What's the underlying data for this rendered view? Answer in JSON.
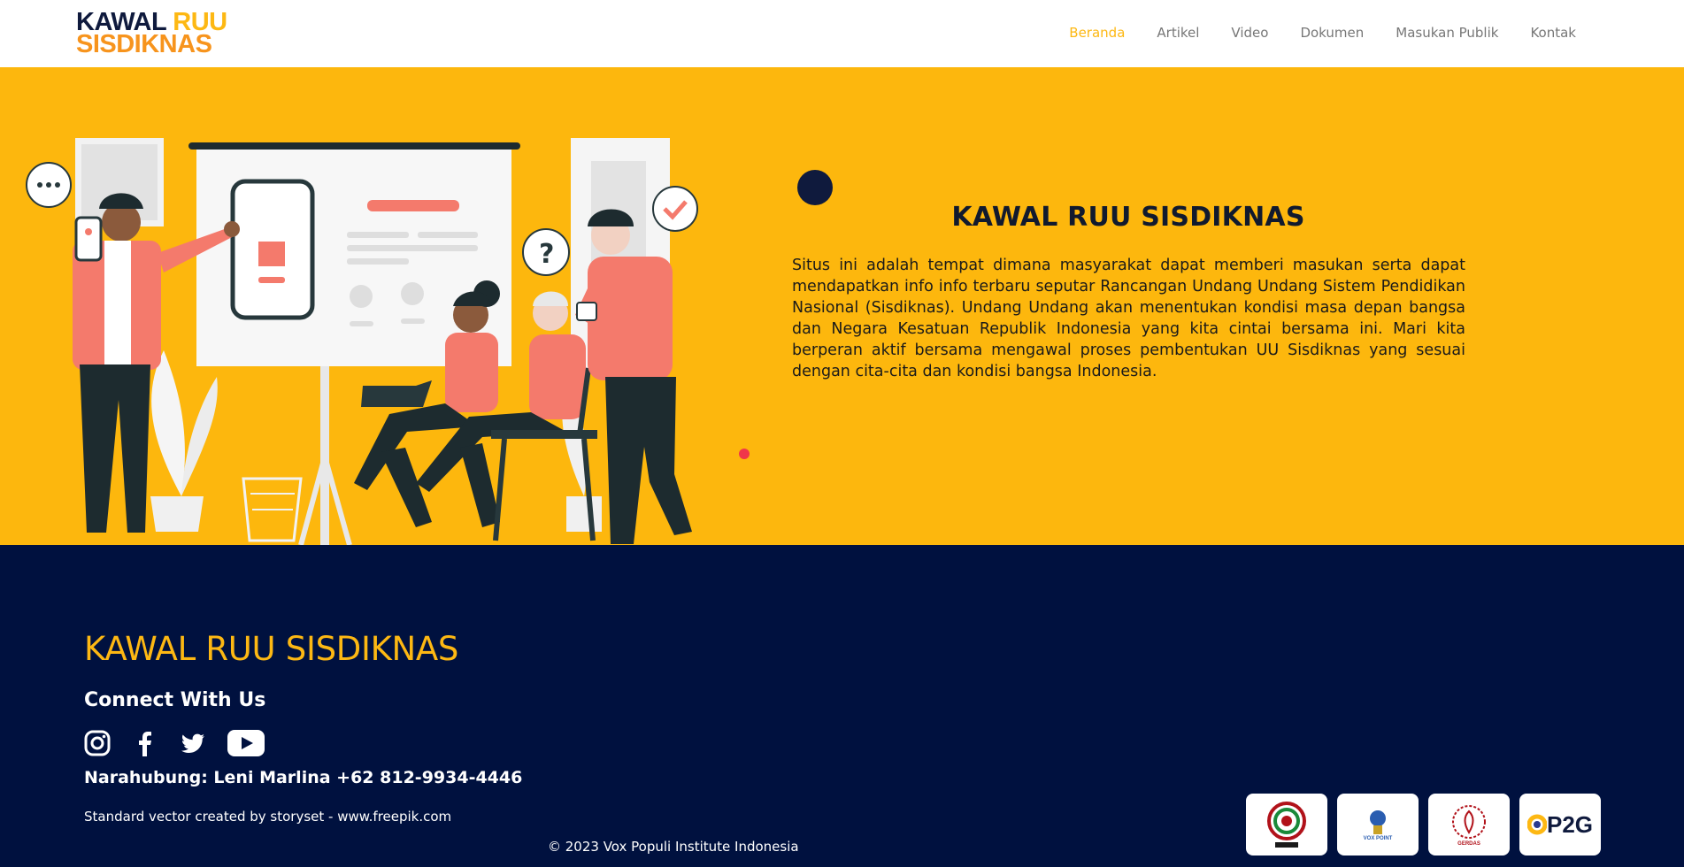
{
  "brand": {
    "line1_a": "KAWAL ",
    "line1_b": "RUU",
    "line2": "SISDIKNAS"
  },
  "nav": {
    "items": [
      {
        "label": "Beranda",
        "active": true
      },
      {
        "label": "Artikel",
        "active": false
      },
      {
        "label": "Video",
        "active": false
      },
      {
        "label": "Dokumen",
        "active": false
      },
      {
        "label": "Masukan Publik",
        "active": false
      },
      {
        "label": "Kontak",
        "active": false
      }
    ]
  },
  "hero": {
    "title": "KAWAL RUU SISDIKNAS",
    "text": "Situs ini adalah tempat dimana masyarakat dapat memberi masukan serta dapat mendapatkan info info terbaru seputar Rancangan Undang Undang Sistem Pendidikan Nasional (Sisdiknas). Undang Undang akan menentukan kondisi masa depan bangsa dan Negara Kesatuan Republik Indonesia yang kita cintai bersama ini. Mari kita berperan aktif bersama mengawal proses pembentukan UU Sisdiknas yang sesuai dengan cita-cita dan kondisi bangsa Indonesia."
  },
  "footer": {
    "title": "KAWAL RUU SISDIKNAS",
    "connect": "Connect With Us",
    "social_icons": [
      "instagram-icon",
      "facebook-icon",
      "twitter-icon",
      "youtube-icon"
    ],
    "contact": "Narahubung: Leni Marlina +62 812-9934-4446",
    "credit": "Standard vector created by storyset - www.freepik.com",
    "copyright": "© 2023 Vox Populi Institute Indonesia",
    "partners": [
      {
        "name": "partner-logo-1"
      },
      {
        "name": "partner-logo-voxpoint",
        "caption": "VOX POINT"
      },
      {
        "name": "partner-logo-gerdas",
        "caption": "GERDAS"
      },
      {
        "name": "partner-logo-p2g",
        "caption": "P2G"
      }
    ]
  },
  "colors": {
    "accent_yellow": "#fdb813",
    "hero_bg": "#fdb70d",
    "navy": "#00113f",
    "coral": "#f47a6c"
  }
}
